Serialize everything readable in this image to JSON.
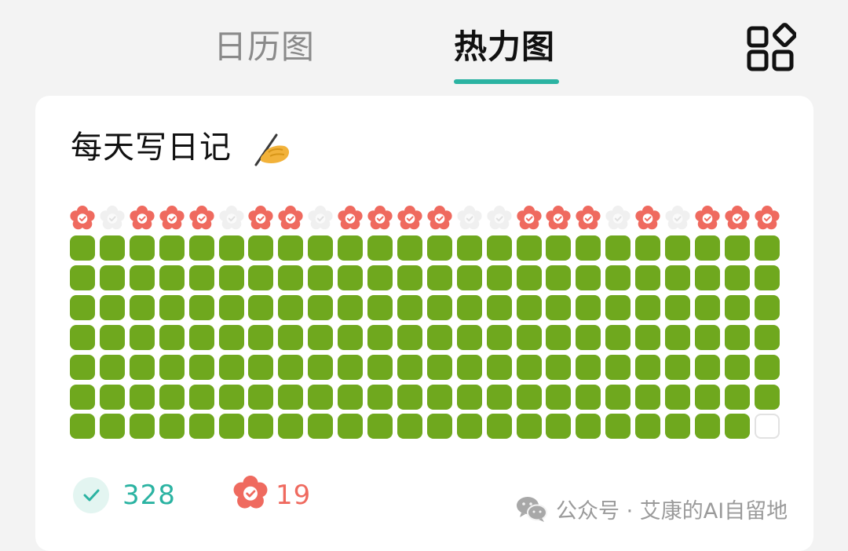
{
  "tabs": [
    {
      "label": "日历图",
      "active": false
    },
    {
      "label": "热力图",
      "active": true
    }
  ],
  "toolbar": {
    "apps_icon": "apps-grid-icon"
  },
  "habit": {
    "title": "每天写日记",
    "emoji": "writing-hand-emoji"
  },
  "heatmap": {
    "columns": 24,
    "rows": 7,
    "week_flowers": [
      1,
      0,
      1,
      1,
      1,
      0,
      1,
      1,
      0,
      1,
      1,
      1,
      1,
      0,
      0,
      1,
      1,
      1,
      0,
      1,
      0,
      1,
      1,
      1
    ],
    "empty_cells": [
      [
        6,
        23
      ]
    ],
    "colors": {
      "done": "#6fa81e",
      "empty": "#ffffff",
      "flower_earned": "#ef6a5f",
      "flower_missed": "#f0f0f0"
    }
  },
  "stats": {
    "done_icon": "check-circle-icon",
    "done_count": "328",
    "perfect_icon": "flower-badge-icon",
    "perfect_count": "19"
  },
  "watermark": {
    "icon": "wechat-icon",
    "text": "公众号 · 艾康的AI自留地"
  },
  "colors": {
    "accent": "#2bb3a2",
    "background": "#f3f3f3",
    "card": "#ffffff"
  }
}
